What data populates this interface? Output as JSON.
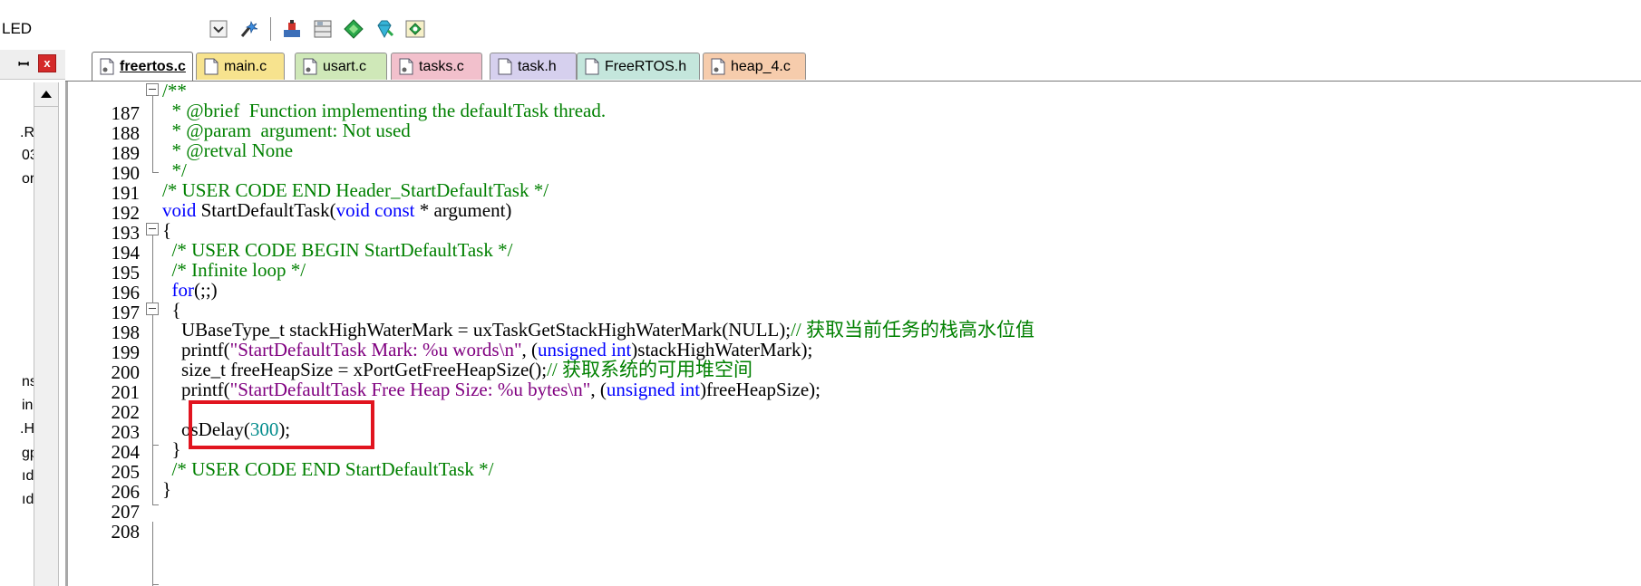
{
  "toolbar": {
    "left_label": "LED",
    "icons": [
      "dropdown-check-icon",
      "wand-icon",
      "load-icon",
      "windows-icon",
      "diamond-icon",
      "gem-icon",
      "manage-icon"
    ]
  },
  "left_panel": {
    "pin_glyph": "ꟷ",
    "close_glyph": "x",
    "tree_fragments": [
      ".R",
      "03",
      "or",
      "ns",
      "in",
      ".H",
      "gp",
      "ıd",
      "ıd"
    ]
  },
  "tabs": [
    {
      "label": "freertos.c",
      "active": true,
      "color": "#ffffff",
      "icon": "c-source-icon"
    },
    {
      "label": "main.c",
      "active": false,
      "color": "#f7e38e",
      "icon": "header-doc-icon"
    },
    {
      "label": "usart.c",
      "active": false,
      "color": "#cfe8b8",
      "icon": "c-source-icon"
    },
    {
      "label": "tasks.c",
      "active": false,
      "color": "#f2c0cc",
      "icon": "c-source-icon"
    },
    {
      "label": "task.h",
      "active": false,
      "color": "#d6d0ee",
      "icon": "header-doc-icon"
    },
    {
      "label": "FreeRTOS.h",
      "active": false,
      "color": "#c4e6dc",
      "icon": "header-doc-icon"
    },
    {
      "label": "heap_4.c",
      "active": false,
      "color": "#f6ccac",
      "icon": "c-source-icon"
    }
  ],
  "code": {
    "lines": [
      {
        "n": "187",
        "t": "/**"
      },
      {
        "n": "188",
        "t": "  * @brief  Function implementing the defaultTask thread."
      },
      {
        "n": "189",
        "t": "  * @param  argument: Not used"
      },
      {
        "n": "190",
        "t": "  * @retval None"
      },
      {
        "n": "191",
        "t": "  */"
      },
      {
        "n": "192",
        "t": "/* USER CODE END Header_StartDefaultTask */"
      },
      {
        "n": "193",
        "t": "void StartDefaultTask(void const * argument)"
      },
      {
        "n": "194",
        "t": "{"
      },
      {
        "n": "195",
        "t": "  /* USER CODE BEGIN StartDefaultTask */"
      },
      {
        "n": "196",
        "t": "  /* Infinite loop */"
      },
      {
        "n": "197",
        "t": "  for(;;)"
      },
      {
        "n": "198",
        "t": "  {"
      },
      {
        "n": "199",
        "t": "    UBaseType_t stackHighWaterMark = uxTaskGetStackHighWaterMark(NULL);// 获取当前任务的栈高水位值"
      },
      {
        "n": "200",
        "t": "    printf(\"StartDefaultTask Mark: %u words\\n\", (unsigned int)stackHighWaterMark);"
      },
      {
        "n": "201",
        "t": "    size_t freeHeapSize = xPortGetFreeHeapSize();// 获取系统的可用堆空间"
      },
      {
        "n": "202",
        "t": "    printf(\"StartDefaultTask Free Heap Size: %u bytes\\n\", (unsigned int)freeHeapSize);"
      },
      {
        "n": "203",
        "t": ""
      },
      {
        "n": "204",
        "t": "    osDelay(300);"
      },
      {
        "n": "205",
        "t": "  }"
      },
      {
        "n": "206",
        "t": "  /* USER CODE END StartDefaultTask */"
      },
      {
        "n": "207",
        "t": "}"
      },
      {
        "n": "208",
        "t": ""
      }
    ],
    "tokens": {
      "l187": "/**",
      "l188": "  * @brief  Function implementing the defaultTask thread.",
      "l189": "  * @param  argument: Not used",
      "l190": "  * @retval None",
      "l191": "  */",
      "l192": "/* USER CODE END Header_StartDefaultTask */",
      "l193_kw1": "void",
      "l193_mid": " StartDefaultTask(",
      "l193_kw2": "void const",
      "l193_end": " * argument)",
      "l194": "{",
      "l195": "  /* USER CODE BEGIN StartDefaultTask */",
      "l196": "  /* Infinite loop */",
      "l197_pre": "  ",
      "l197_kw": "for",
      "l197_end": "(;;)",
      "l198": "  {",
      "l199_code": "    UBaseType_t stackHighWaterMark = uxTaskGetStackHighWaterMark(NULL);",
      "l199_cmt": "// 获取当前任务的栈高水位值",
      "l200_pre": "    printf(",
      "l200_str": "\"StartDefaultTask Mark: %u words\\n\"",
      "l200_mid": ", (",
      "l200_kw": "unsigned int",
      "l200_end": ")stackHighWaterMark);",
      "l201_code": "    size_t freeHeapSize = xPortGetFreeHeapSize();",
      "l201_cmt": "// 获取系统的可用堆空间",
      "l202_pre": "    printf(",
      "l202_str": "\"StartDefaultTask Free Heap Size: %u bytes\\n\"",
      "l202_mid": ", (",
      "l202_kw": "unsigned int",
      "l202_end": ")freeHeapSize);",
      "l204_pre": "    osDelay(",
      "l204_num": "300",
      "l204_end": ");",
      "l205": "  }",
      "l206": "  /* USER CODE END StartDefaultTask */",
      "l207": "}"
    }
  },
  "colors": {
    "comment": "#008000",
    "keyword": "#0000ff",
    "string": "#800080",
    "number": "#008b8b",
    "highlight_box": "#e1141f"
  }
}
